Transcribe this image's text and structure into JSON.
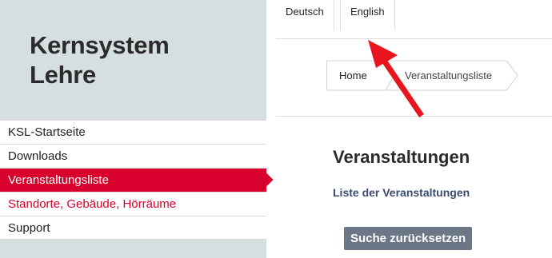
{
  "brand": {
    "line1": "Kernsystem",
    "line2": "Lehre"
  },
  "nav": [
    {
      "label": "KSL-Startseite",
      "state": "normal"
    },
    {
      "label": "Downloads",
      "state": "normal"
    },
    {
      "label": "Veranstaltungsliste",
      "state": "active"
    },
    {
      "label": "Standorte, Gebäude, Hörräume",
      "state": "highlight"
    },
    {
      "label": "Support",
      "state": "normal"
    }
  ],
  "languages": {
    "de": "Deutsch",
    "en": "English"
  },
  "breadcrumb": {
    "home": "Home",
    "current": "Veranstaltungsliste"
  },
  "main": {
    "title": "Veranstaltungen",
    "subtitle_link": "Liste der Veranstaltungen",
    "reset_button": "Suche zurücksetzen"
  },
  "colors": {
    "accent_red": "#d8002c",
    "sidebar_bg": "#d5dfe0",
    "button_bg": "#6b7687",
    "link_blue": "#3a4a6e",
    "annotation_arrow": "#e8141e"
  }
}
